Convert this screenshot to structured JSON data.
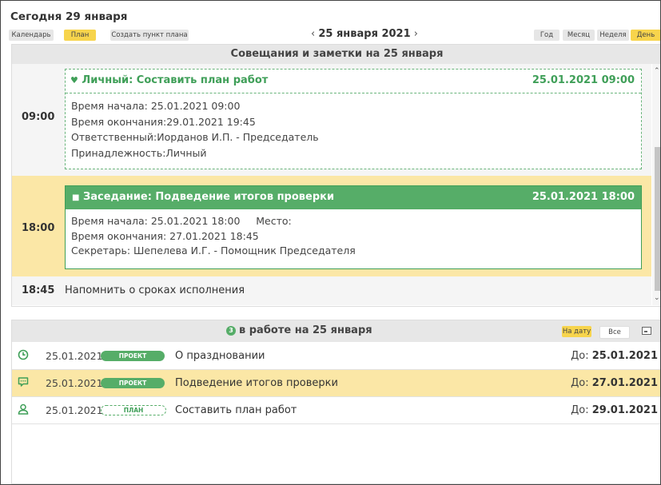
{
  "header": {
    "today_label": "Сегодня 29 января",
    "buttons": {
      "calendar": "Календарь",
      "plan": "План",
      "create": "Создать пункт плана",
      "year": "Год",
      "month": "Месяц",
      "week": "Неделя",
      "day": "День"
    },
    "date_nav": {
      "prev": "‹",
      "date": "25 января 2021",
      "next": "›"
    }
  },
  "meetings_panel": {
    "title": "Совещания и заметки на 25 января",
    "slots": [
      {
        "time": "09:00",
        "card": {
          "icon": "person-icon",
          "title": "Личный: Составить план работ",
          "datetime": "25.01.2021 09:00",
          "lines": [
            "Время начала: 25.01.2021 09:00",
            "Время окончания:29.01.2021 19:45",
            "Ответственный:Иорданов И.П. - Председатель",
            "Принадлежность:Личный"
          ]
        }
      },
      {
        "time": "18:00",
        "card": {
          "icon": "chat-icon",
          "title": "Заседание:  Подведение итогов проверки",
          "datetime": "25.01.2021 18:00",
          "lines": [
            "Время начала: 25.01.2021 18:00     Место:",
            "Время окончания: 27.01.2021 18:45",
            "Секретарь: Шепелева И.Г. - Помощник Председателя"
          ]
        }
      },
      {
        "time": "18:45",
        "text": "Напомнить о сроках исполнения"
      }
    ]
  },
  "work_panel": {
    "count": "3",
    "title": "в работе на 25 января",
    "filters": {
      "by_date": "На дату",
      "all": "Все"
    },
    "rows": [
      {
        "icon": "clock-icon",
        "date": "25.01.2021",
        "tag": "ПРОЕКТ",
        "name": "О праздновании",
        "due_prefix": "До:",
        "due": "25.01.2021"
      },
      {
        "icon": "chat-icon",
        "date": "25.01.2021",
        "tag": "ПРОЕКТ",
        "name": "Подведение итогов проверки",
        "due_prefix": "До:",
        "due": "27.01.2021"
      },
      {
        "icon": "person-icon",
        "date": "25.01.2021",
        "tag": "ПЛАН",
        "name": "Составить план работ",
        "due_prefix": "До:",
        "due": "29.01.2021"
      }
    ]
  },
  "colors": {
    "accent_green": "#56ad68",
    "highlight_yellow": "#fbe7a6",
    "active_button": "#f7d44c"
  }
}
